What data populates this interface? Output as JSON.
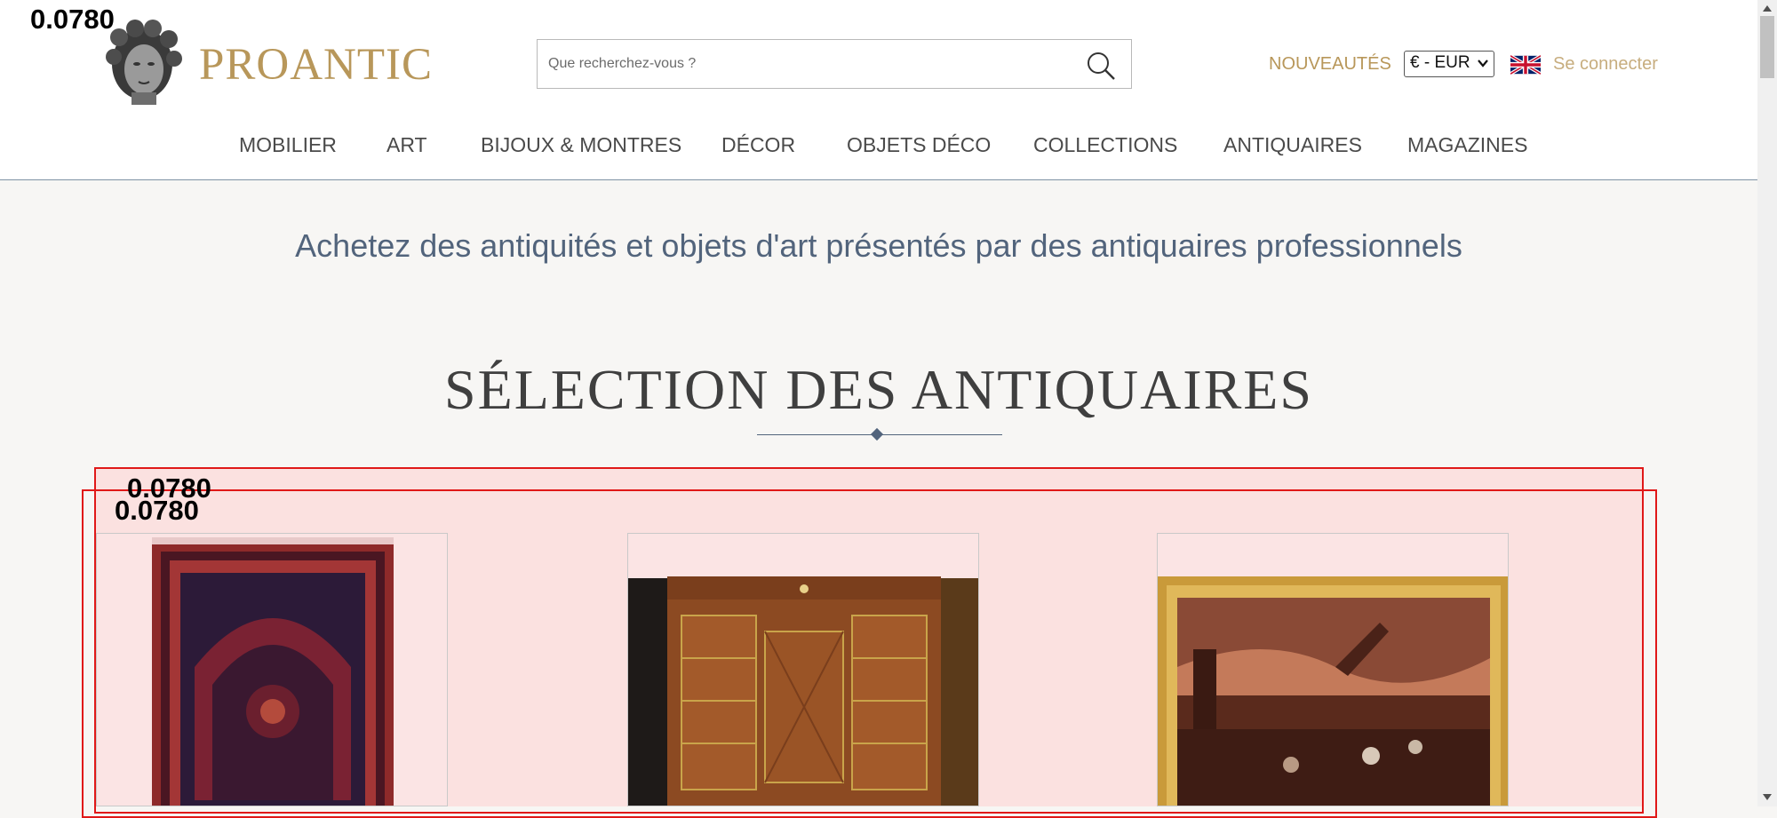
{
  "debug": {
    "top_label": "0.0780",
    "box_label_1": "0.0780",
    "box_label_2": "0.0780"
  },
  "header": {
    "logo_text": "PROANTIC",
    "search": {
      "placeholder": "Que recherchez-vous ?"
    },
    "nav_new": "NOUVEAUTÉS",
    "currency": {
      "selected": "€ - EUR"
    },
    "login": "Se connecter"
  },
  "menu": {
    "items": [
      {
        "label": "MOBILIER"
      },
      {
        "label": "ART"
      },
      {
        "label": "BIJOUX & MONTRES"
      },
      {
        "label": "DÉCOR"
      },
      {
        "label": "OBJETS DÉCO"
      },
      {
        "label": "COLLECTIONS"
      },
      {
        "label": "ANTIQUAIRES"
      },
      {
        "label": "MAGAZINES"
      }
    ]
  },
  "hero": {
    "tagline": "Achetez des antiquités et objets d'art présentés par des antiquaires professionnels",
    "section_title": "SÉLECTION DES ANTIQUAIRES"
  },
  "colors": {
    "brand_gold": "#b8975a",
    "slate_blue": "#52647c",
    "debug_red": "#e01818"
  }
}
